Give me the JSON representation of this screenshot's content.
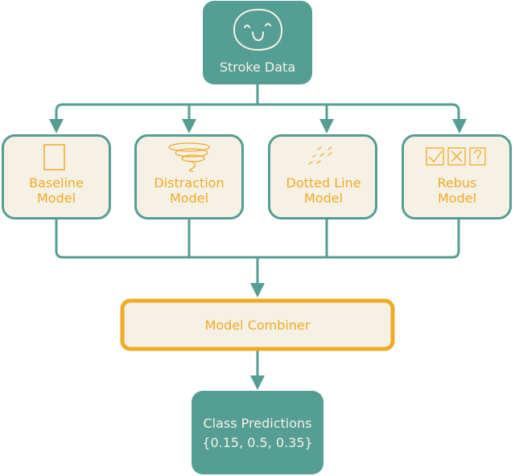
{
  "colors": {
    "teal": "#559e94",
    "orange": "#f0ab26",
    "cream": "#f6f1e5"
  },
  "source": {
    "label": "Stroke Data",
    "icon": "smiley-face-icon"
  },
  "models": [
    {
      "line1": "Baseline",
      "line2": "Model",
      "icon": "square-icon"
    },
    {
      "line1": "Distraction",
      "line2": "Model",
      "icon": "scribble-icon"
    },
    {
      "line1": "Dotted Line",
      "line2": "Model",
      "icon": "dotted-lines-icon"
    },
    {
      "line1": "Rebus",
      "line2": "Model",
      "icon": "check-x-question-icons"
    }
  ],
  "combiner": {
    "label": "Model Combiner"
  },
  "output": {
    "line1": "Class Predictions",
    "line2": "{0.15, 0.5, 0.35}"
  }
}
